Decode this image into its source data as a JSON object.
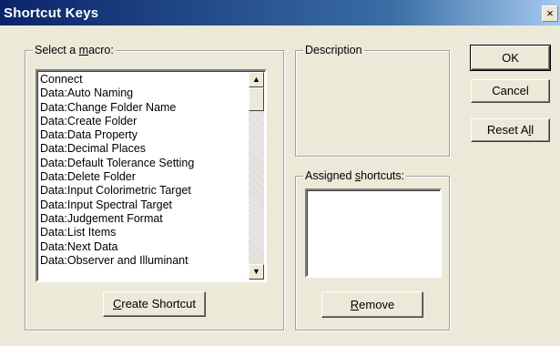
{
  "window": {
    "title": "Shortcut Keys",
    "close_glyph": "×"
  },
  "select_macro": {
    "label_pre": "Select a ",
    "label_mnemonic": "m",
    "label_post": "acro:",
    "items": [
      "Connect",
      "Data:Auto Naming",
      "Data:Change Folder Name",
      "Data:Create Folder",
      "Data:Data Property",
      "Data:Decimal Places",
      "Data:Default Tolerance Setting",
      "Data:Delete Folder",
      "Data:Input Colorimetric Target",
      "Data:Input Spectral Target",
      "Data:Judgement Format",
      "Data:List Items",
      "Data:Next Data",
      "Data:Observer and Illuminant"
    ],
    "create_button_mnemonic": "C",
    "create_button_rest": "reate Shortcut"
  },
  "description": {
    "label": "Description"
  },
  "assigned": {
    "label_pre": "Assigned ",
    "label_mnemonic": "s",
    "label_post": "hortcuts:",
    "remove_mnemonic": "R",
    "remove_rest": "emove"
  },
  "buttons": {
    "ok": "OK",
    "cancel": "Cancel",
    "reset_pre": "Reset A",
    "reset_mnemonic": "l",
    "reset_post": "l"
  },
  "scroll": {
    "up_glyph": "▲",
    "down_glyph": "▼"
  }
}
